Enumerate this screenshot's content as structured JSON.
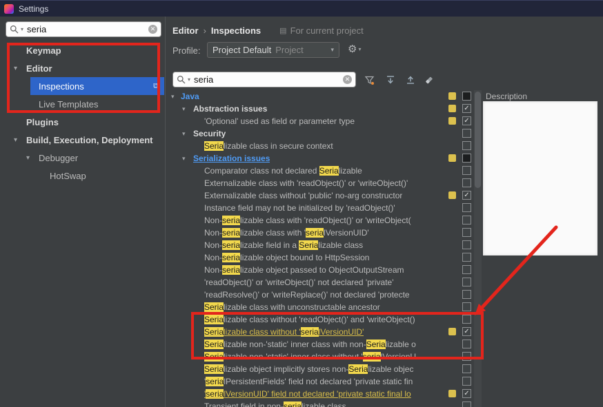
{
  "window": {
    "title": "Settings"
  },
  "colors": {
    "annotation_red": "#e3251c",
    "selection_blue": "#2e65c9",
    "match_highlight_yellow": "#f3d94d",
    "severity_badge_yellow": "#dcc14e",
    "panel_background": "#3c3f41",
    "titlebar_background": "#212539"
  },
  "icons": {
    "chevron_down": "▾",
    "dropdown_caret": "▾",
    "gear": "⚙",
    "external_link": "⧉",
    "clear": "✕",
    "scope": "▤",
    "breadcrumb_separator": "›"
  },
  "sidebar": {
    "search": {
      "value": "seria"
    },
    "items": [
      {
        "label": "Keymap",
        "level": 0,
        "bold": true
      },
      {
        "label": "Editor",
        "level": 0,
        "bold": true,
        "chevron": true
      },
      {
        "label": "Inspections",
        "level": 1,
        "selected": true,
        "trailing_icon": true
      },
      {
        "label": "Live Templates",
        "level": 1
      },
      {
        "label": "Plugins",
        "level": 0,
        "bold": true
      },
      {
        "label": "Build, Execution, Deployment",
        "level": 0,
        "bold": true,
        "chevron": true
      },
      {
        "label": "Debugger",
        "level": 1,
        "chevron": true
      },
      {
        "label": "HotSwap",
        "level": 2
      }
    ]
  },
  "header": {
    "breadcrumb": [
      "Editor",
      "Inspections"
    ],
    "scope_note": "For current project",
    "profile_label": "Profile:",
    "profile_value": "Project Default",
    "profile_scope": "Project"
  },
  "toolbar": {
    "search_value": "seria",
    "buttons": [
      "filter",
      "expand-all",
      "collapse-all",
      "reset-filter"
    ]
  },
  "inspections": {
    "rows": [
      {
        "level": 0,
        "chevron": true,
        "style": "blue",
        "parts": [
          {
            "t": "Java"
          }
        ],
        "badge": true,
        "checkbox": "partial"
      },
      {
        "level": 1,
        "chevron": true,
        "style": "group",
        "parts": [
          {
            "t": "Abstraction issues"
          }
        ],
        "badge": true,
        "checkbox": "checked"
      },
      {
        "level": 2,
        "parts": [
          {
            "t": "'Optional' used as field or parameter type"
          }
        ],
        "badge": true,
        "checkbox": "checked"
      },
      {
        "level": 1,
        "chevron": true,
        "style": "group",
        "parts": [
          {
            "t": "Security"
          }
        ],
        "checkbox": "unchecked"
      },
      {
        "level": 2,
        "parts": [
          {
            "t": "Seria",
            "h": true
          },
          {
            "t": "lizable class in secure context"
          }
        ],
        "checkbox": "unchecked"
      },
      {
        "level": 1,
        "chevron": true,
        "style": "blue",
        "underline": true,
        "parts": [
          {
            "t": "Serialization issues"
          }
        ],
        "badge": true,
        "checkbox": "partial"
      },
      {
        "level": 2,
        "parts": [
          {
            "t": "Comparator class not declared "
          },
          {
            "t": "Seria",
            "h": true
          },
          {
            "t": "lizable"
          }
        ],
        "checkbox": "unchecked"
      },
      {
        "level": 2,
        "parts": [
          {
            "t": "Externalizable class with 'readObject()' or 'writeObject()'"
          }
        ],
        "checkbox": "unchecked"
      },
      {
        "level": 2,
        "parts": [
          {
            "t": "Externalizable class without 'public' no-arg constructor"
          }
        ],
        "badge": true,
        "checkbox": "checked"
      },
      {
        "level": 2,
        "parts": [
          {
            "t": "Instance field may not be initialized by 'readObject()'"
          }
        ],
        "checkbox": "unchecked"
      },
      {
        "level": 2,
        "parts": [
          {
            "t": "Non-"
          },
          {
            "t": "seria",
            "h": true
          },
          {
            "t": "lizable class with 'readObject()' or 'writeObject("
          }
        ],
        "checkbox": "unchecked"
      },
      {
        "level": 2,
        "parts": [
          {
            "t": "Non-"
          },
          {
            "t": "seria",
            "h": true
          },
          {
            "t": "lizable class with '"
          },
          {
            "t": "seria",
            "h": true
          },
          {
            "t": "lVersionUID'"
          }
        ],
        "checkbox": "unchecked"
      },
      {
        "level": 2,
        "parts": [
          {
            "t": "Non-"
          },
          {
            "t": "seria",
            "h": true
          },
          {
            "t": "lizable field in a "
          },
          {
            "t": "Seria",
            "h": true
          },
          {
            "t": "lizable class"
          }
        ],
        "checkbox": "unchecked"
      },
      {
        "level": 2,
        "parts": [
          {
            "t": "Non-"
          },
          {
            "t": "seria",
            "h": true
          },
          {
            "t": "lizable object bound to HttpSession"
          }
        ],
        "checkbox": "unchecked"
      },
      {
        "level": 2,
        "parts": [
          {
            "t": "Non-"
          },
          {
            "t": "seria",
            "h": true
          },
          {
            "t": "lizable object passed to ObjectOutputStream"
          }
        ],
        "checkbox": "unchecked"
      },
      {
        "level": 2,
        "parts": [
          {
            "t": "'readObject()' or 'writeObject()' not declared 'private'"
          }
        ],
        "checkbox": "unchecked"
      },
      {
        "level": 2,
        "parts": [
          {
            "t": "'readResolve()' or 'writeReplace()' not declared 'protecte"
          }
        ],
        "checkbox": "unchecked"
      },
      {
        "level": 2,
        "parts": [
          {
            "t": "Seria",
            "h": true
          },
          {
            "t": "lizable class with unconstructable ancestor"
          }
        ],
        "checkbox": "unchecked"
      },
      {
        "level": 2,
        "parts": [
          {
            "t": "Seria",
            "h": true
          },
          {
            "t": "lizable class without 'readObject()' and 'writeObject()"
          }
        ],
        "checkbox": "unchecked"
      },
      {
        "level": 2,
        "style": "yellow",
        "underline": true,
        "parts": [
          {
            "t": "Seria",
            "h": true
          },
          {
            "t": "lizable class without '"
          },
          {
            "t": "seria",
            "h": true
          },
          {
            "t": "lVersionUID'"
          }
        ],
        "badge": true,
        "checkbox": "checked"
      },
      {
        "level": 2,
        "parts": [
          {
            "t": "Seria",
            "h": true
          },
          {
            "t": "lizable non-'static' inner class with non-"
          },
          {
            "t": "Seria",
            "h": true
          },
          {
            "t": "lizable o"
          }
        ],
        "checkbox": "unchecked"
      },
      {
        "level": 2,
        "parts": [
          {
            "t": "Seria",
            "h": true
          },
          {
            "t": "lizable non-'static' inner class without '"
          },
          {
            "t": "seria",
            "h": true
          },
          {
            "t": "lVersionU"
          }
        ],
        "checkbox": "unchecked"
      },
      {
        "level": 2,
        "parts": [
          {
            "t": "Seria",
            "h": true
          },
          {
            "t": "lizable object implicitly stores non-"
          },
          {
            "t": "Seria",
            "h": true
          },
          {
            "t": "lizable objec"
          }
        ],
        "checkbox": "unchecked"
      },
      {
        "level": 2,
        "parts": [
          {
            "t": "'"
          },
          {
            "t": "seria",
            "h": true
          },
          {
            "t": "lPersistentFields' field not declared 'private static fin"
          }
        ],
        "checkbox": "unchecked"
      },
      {
        "level": 2,
        "style": "yellow",
        "underline": true,
        "parts": [
          {
            "t": "'"
          },
          {
            "t": "seria",
            "h": true
          },
          {
            "t": "lVersionUID' field not declared 'private static final lo"
          }
        ],
        "badge": true,
        "checkbox": "checked"
      },
      {
        "level": 2,
        "parts": [
          {
            "t": "Transient field in non-"
          },
          {
            "t": "seria",
            "h": true
          },
          {
            "t": "lizable class"
          }
        ],
        "checkbox": "unchecked"
      }
    ]
  },
  "description": {
    "title": "Description"
  }
}
